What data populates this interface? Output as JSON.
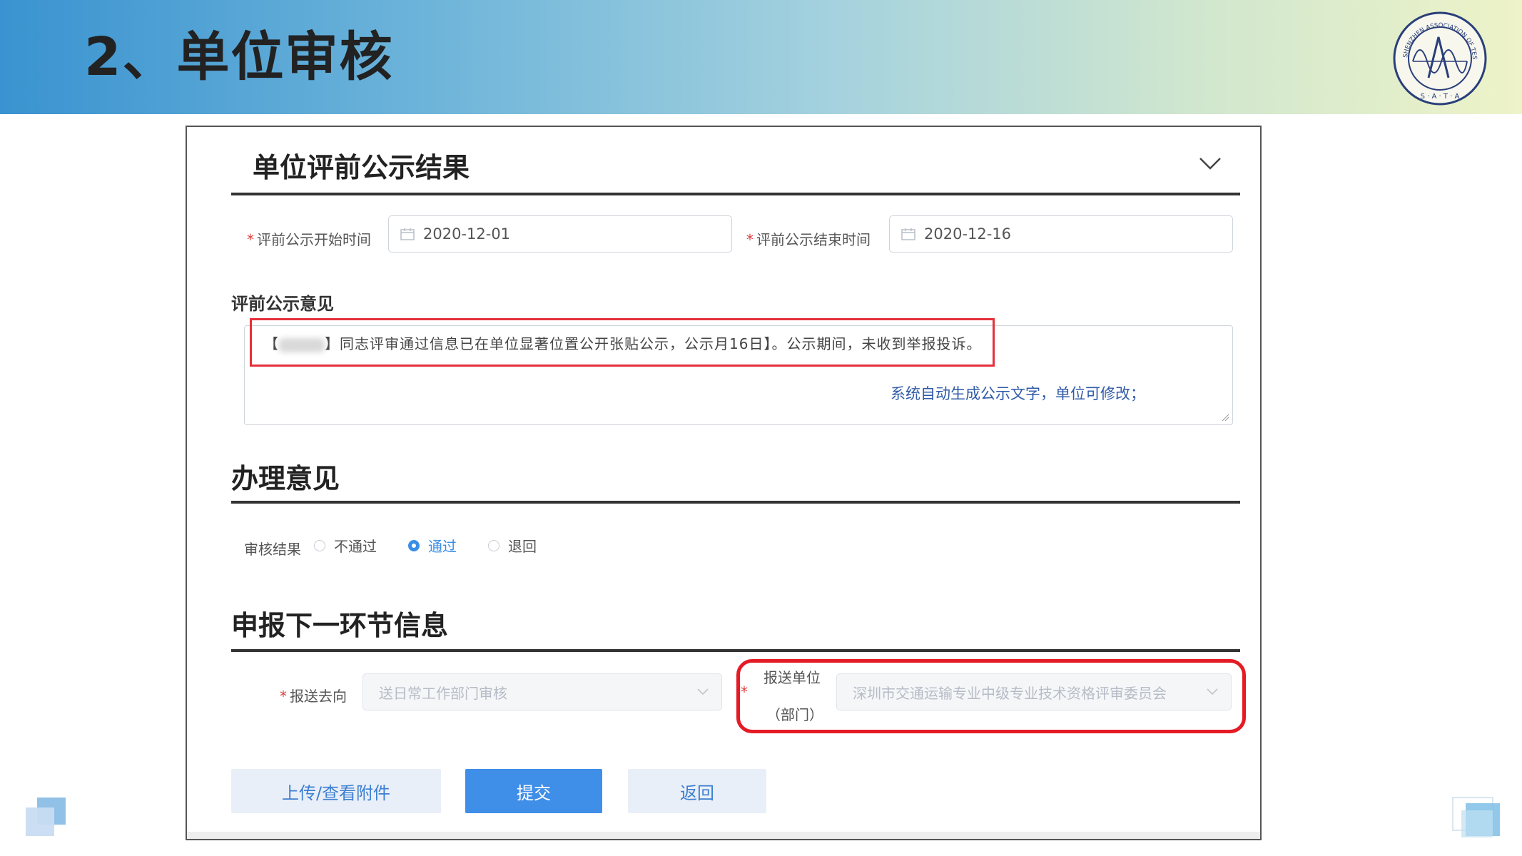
{
  "slide": {
    "title": "2、单位审核"
  },
  "logo": {
    "text_top": "SHENZHEN ASSOCIATION OF TESTERS AND ANALYSIS",
    "text_bottom": "S · A · T · A"
  },
  "notice_section": {
    "title": "单位评前公示结果",
    "start_label": "评前公示开始时间",
    "start_value": "2020-12-01",
    "end_label": "评前公示结束时间",
    "end_value": "2020-12-16",
    "opinion_label": "评前公示意见",
    "opinion_prefix": "【",
    "opinion_text": "】同志评审通过信息已在单位显著位置公开张贴公示，公示月16日】。公示期间，未收到举报投诉。",
    "hint": "系统自动生成公示文字，单位可修改；"
  },
  "handling_section": {
    "title": "办理意见",
    "result_label": "审核结果",
    "options": [
      "不通过",
      "通过",
      "退回"
    ],
    "selected": "通过"
  },
  "next_section": {
    "title": "申报下一环节信息",
    "direction_label": "报送去向",
    "direction_value": "送日常工作部门审核",
    "unit_label_line1": "报送单位",
    "unit_label_line2": "（部门）",
    "unit_value": "深圳市交通运输专业中级专业技术资格评审委员会"
  },
  "buttons": {
    "upload": "上传/查看附件",
    "submit": "提交",
    "back": "返回"
  },
  "colors": {
    "accent_blue": "#3f8ee8",
    "hint_blue": "#2f5aa8",
    "highlight_red": "#e41b25",
    "required_red": "#e23b3b"
  }
}
